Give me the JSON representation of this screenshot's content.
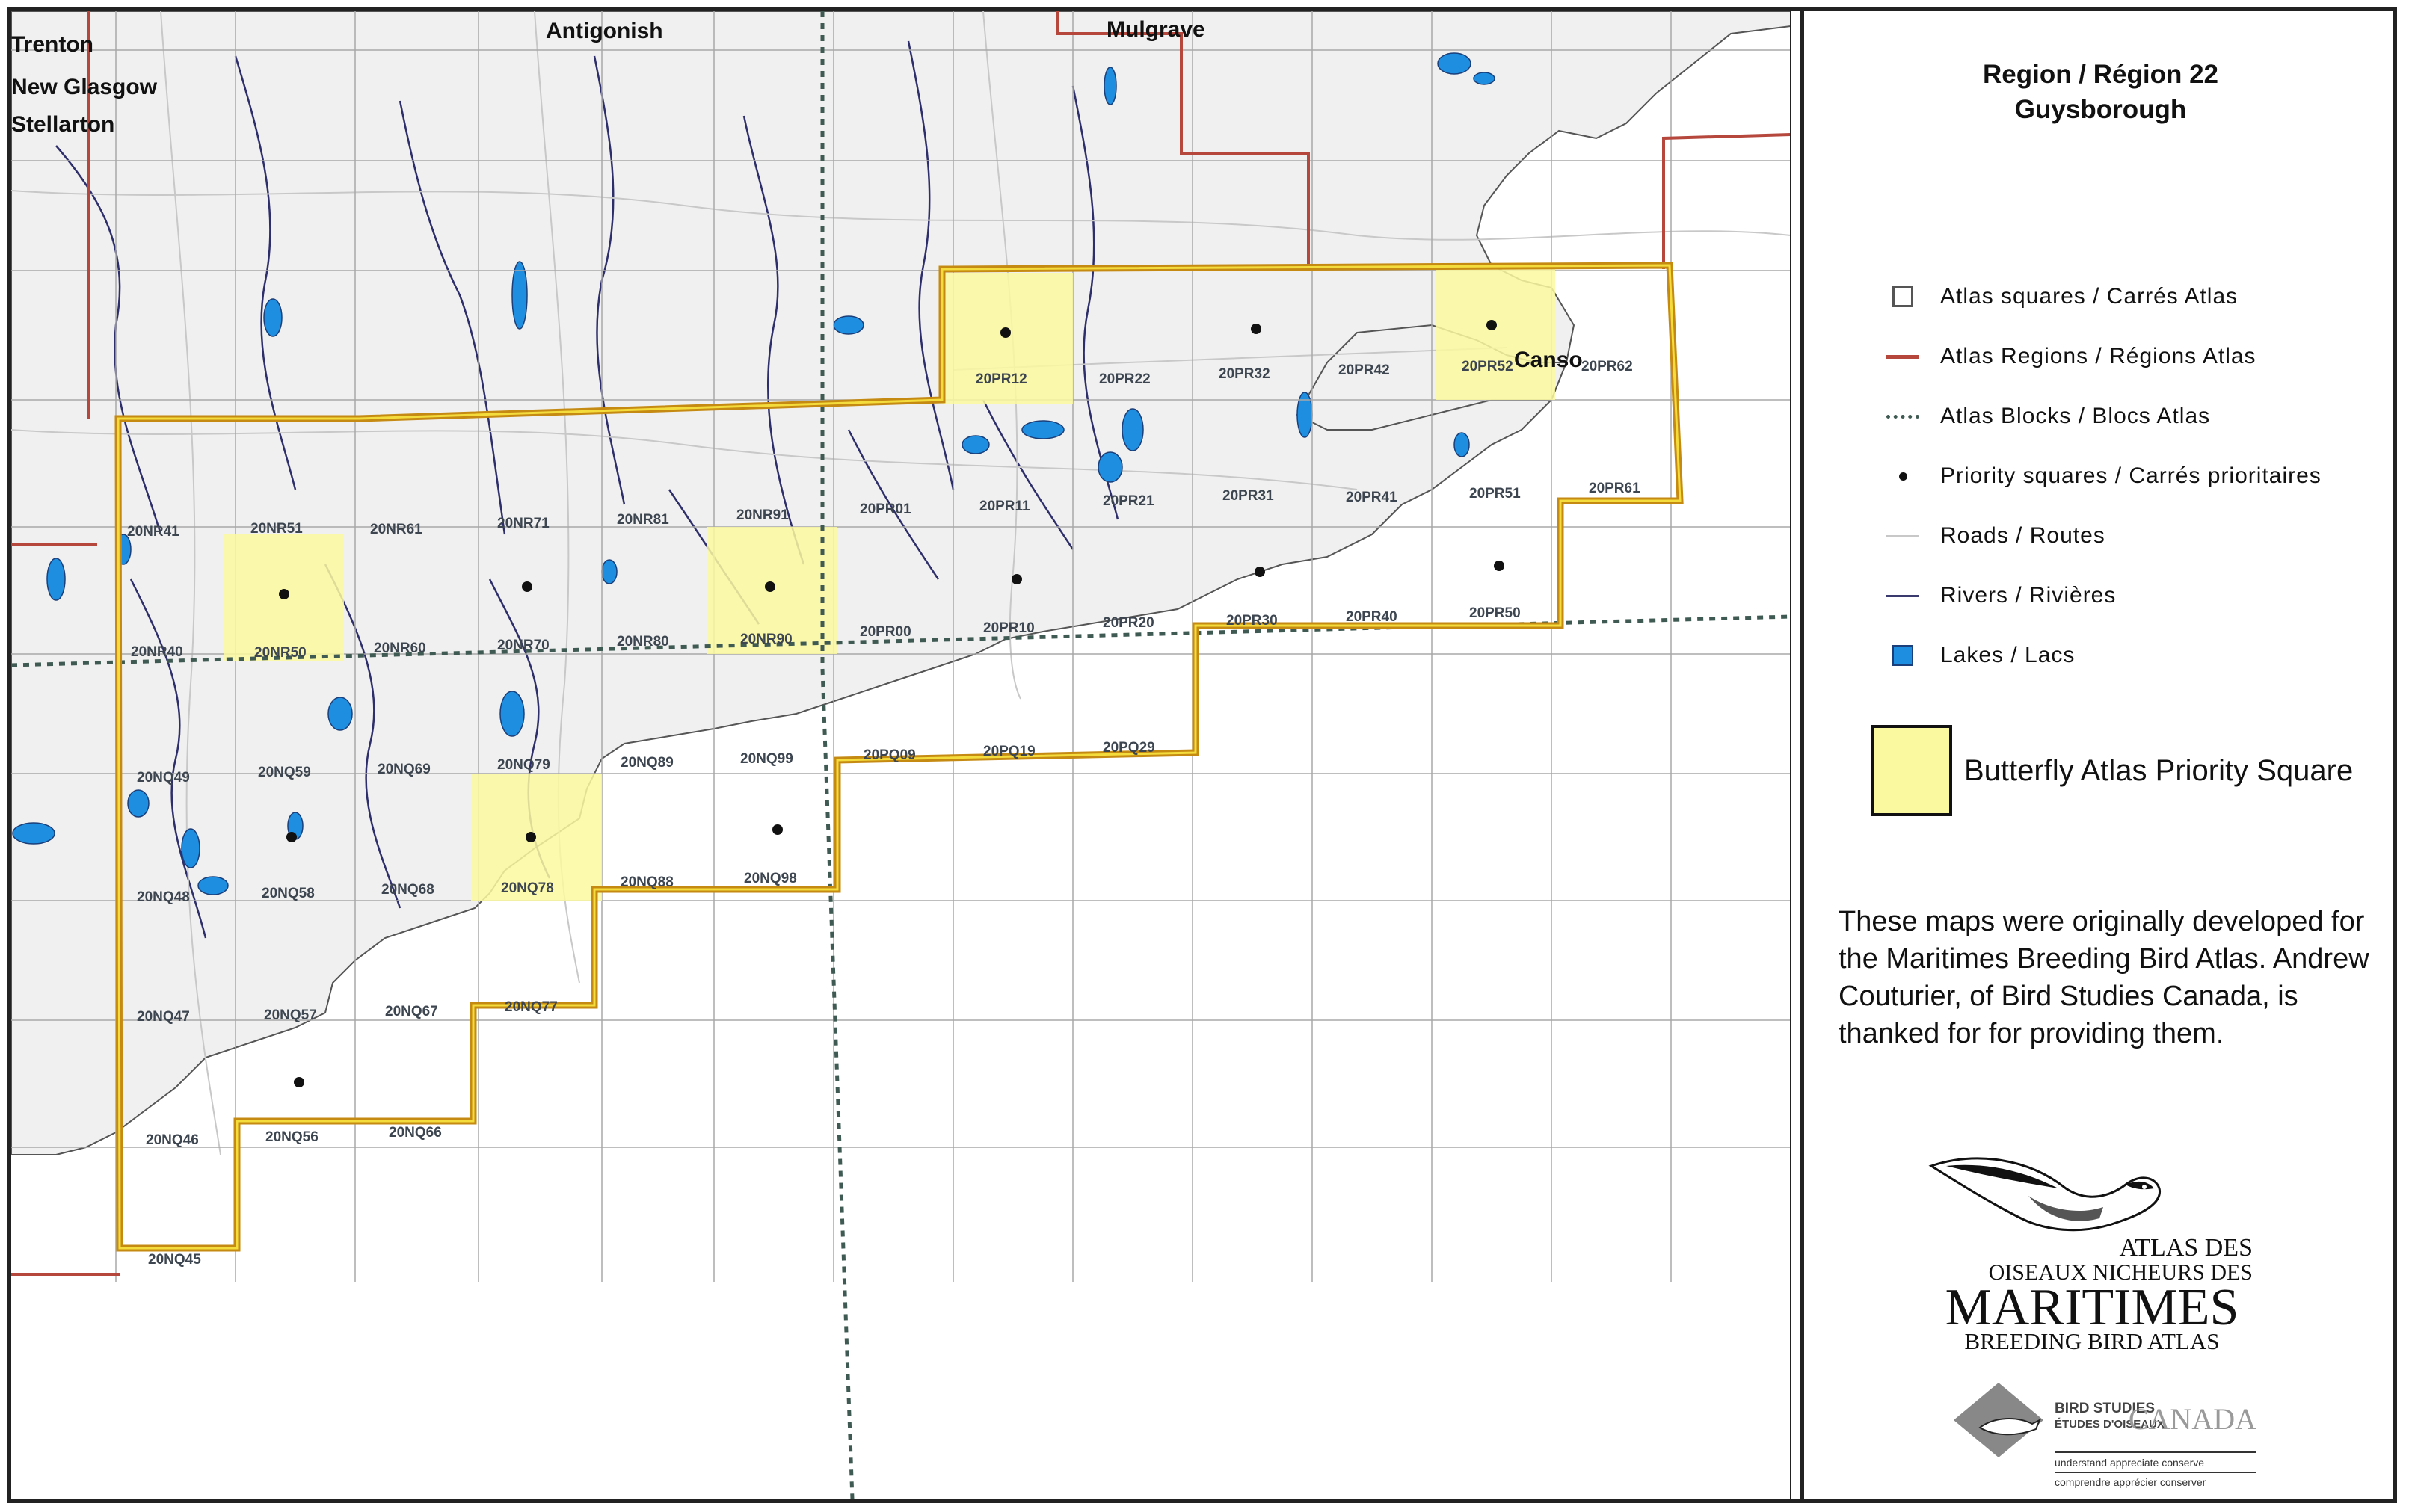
{
  "legend": {
    "title_line1": "Region  /  Région  22",
    "title_line2": "Guysborough",
    "items": [
      {
        "symbol": "atlas-square",
        "label": "Atlas  squares  /  Carrés  Atlas"
      },
      {
        "symbol": "region-line",
        "label": "Atlas  Regions  /  Régions  Atlas"
      },
      {
        "symbol": "block-line",
        "label": "Atlas  Blocks  /  Blocs  Atlas"
      },
      {
        "symbol": "priority-dot",
        "label": "Priority  squares  /  Carrés  prioritaires"
      },
      {
        "symbol": "road-line",
        "label": "Roads  /  Routes"
      },
      {
        "symbol": "river-line",
        "label": "Rivers  /  Rivières"
      },
      {
        "symbol": "lake-square",
        "label": "Lakes  /  Lacs"
      }
    ],
    "butterfly_label": "Butterfly Atlas Priority Square",
    "credit": "These maps were originally developed for the Maritimes Breeding Bird Atlas. Andrew Couturier, of Bird Studies Canada, is thanked for  for providing them."
  },
  "colors": {
    "region_line": "#b5473d",
    "boundary_outline": "#c58a12",
    "boundary_inner": "#f4dc3c",
    "block_line": "#3f5a52",
    "land": "#f0f0f0",
    "grid": "#a8a8a8",
    "road": "#c8c8c8",
    "river": "#2e2e6a",
    "lake": "#1e8fe0",
    "butterfly_square": "#fbf99f",
    "priority_dot": "#111111"
  },
  "map": {
    "towns": [
      "Trenton",
      "New Glasgow",
      "Stellarton",
      "Antigonish",
      "Mulgrave",
      "Canso"
    ],
    "square_labels": [
      "20NR41",
      "20NR51",
      "20NR61",
      "20NR71",
      "20NR81",
      "20NR91",
      "20PR01",
      "20PR11",
      "20PR21",
      "20PR31",
      "20PR41",
      "20PR51",
      "20PR61",
      "20NR40",
      "20NR50",
      "20NR60",
      "20NR70",
      "20NR80",
      "20NR90",
      "20PR00",
      "20PR10",
      "20PR20",
      "20PR30",
      "20PR40",
      "20PR50",
      "20NQ49",
      "20NQ59",
      "20NQ69",
      "20NQ79",
      "20NQ89",
      "20NQ99",
      "20PQ09",
      "20PQ19",
      "20PQ29",
      "20NQ48",
      "20NQ58",
      "20NQ68",
      "20NQ78",
      "20NQ88",
      "20NQ98",
      "20NQ47",
      "20NQ57",
      "20NQ67",
      "20NQ77",
      "20NQ46",
      "20NQ56",
      "20NQ66",
      "20NQ45",
      "20PR12",
      "20PR22",
      "20PR32",
      "20PR42",
      "20PR52",
      "20PR62"
    ]
  },
  "logos": {
    "mbba_line1": "ATLAS DES",
    "mbba_line2": "OISEAUX NICHEURS DES",
    "mbba_line3": "MARITIMES",
    "mbba_line4": "BREEDING BIRD ATLAS",
    "bsc_line1": "BIRD STUDIES",
    "bsc_line2": "ÉTUDES D'OISEAUX",
    "bsc_canada": "CANADA",
    "bsc_tag1": "understand appreciate conserve",
    "bsc_tag2": "comprendre apprécier conserver"
  }
}
